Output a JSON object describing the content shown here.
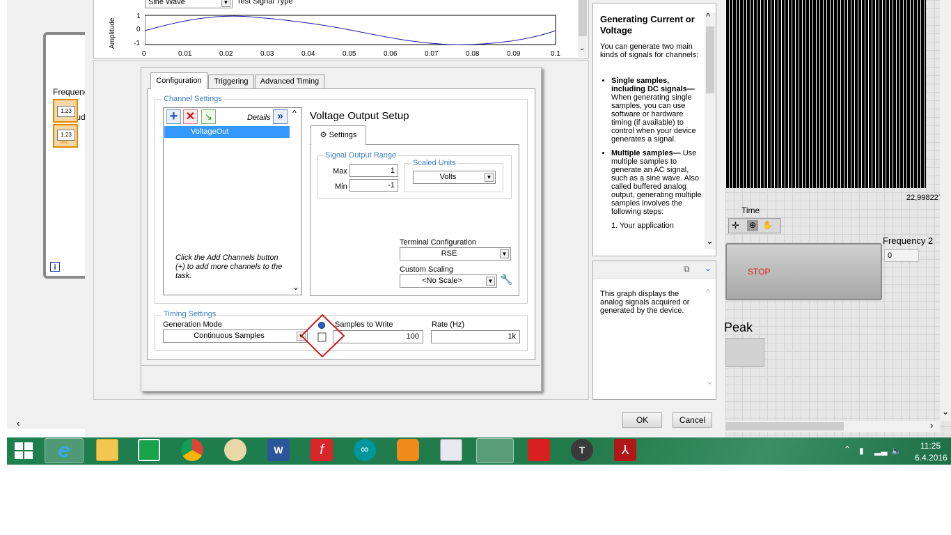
{
  "left_panel": {
    "frequency_label": "Frequenc",
    "amplitude_label": "Amplitud",
    "num_indicator_1": "1.23",
    "num_indicator_2": "1.23",
    "dbl_tag": "DBL",
    "info_icon": "i"
  },
  "test_signal": {
    "type_value": "Sine Wave",
    "type_label": "Test Signal Type",
    "y_label": "Amplitude",
    "y_ticks": [
      "1",
      "0",
      "-1"
    ],
    "x_ticks": [
      "0",
      "0.01",
      "0.02",
      "0.03",
      "0.04",
      "0.05",
      "0.06",
      "0.07",
      "0.08",
      "0.09",
      "0.1"
    ]
  },
  "dialog": {
    "tabs": {
      "configuration": "Configuration",
      "triggering": "Triggering",
      "advanced_timing": "Advanced Timing"
    },
    "channel_settings": {
      "title": "Channel Settings",
      "details_label": "Details",
      "channel": "VoltageOut",
      "hint": "Click the Add Channels button (+) to add more channels to the task."
    },
    "voltage_setup": {
      "title": "Voltage Output Setup",
      "settings_tab": "Settings",
      "signal_output_range": "Signal Output Range",
      "max_label": "Max",
      "max_value": "1",
      "min_label": "Min",
      "min_value": "-1",
      "scaled_units_label": "Scaled Units",
      "scaled_units_value": "Volts",
      "terminal_config_label": "Terminal Configuration",
      "terminal_config_value": "RSE",
      "custom_scaling_label": "Custom Scaling",
      "custom_scaling_value": "<No Scale>"
    },
    "timing": {
      "title": "Timing Settings",
      "generation_mode_label": "Generation Mode",
      "generation_mode_value": "Continuous Samples",
      "samples_label": "Samples to Write",
      "samples_value": "100",
      "rate_label": "Rate (Hz)",
      "rate_value": "1k"
    },
    "ok": "OK",
    "cancel": "Cancel"
  },
  "help": {
    "title": "Generating Current or Voltage",
    "intro": "You can generate two main kinds of signals for channels:",
    "item1_bold": "Single samples, including DC signals—",
    "item1_text": "When generating single samples, you can use software or hardware timing (if available) to control when your device generates a signal.",
    "item2_bold": "Multiple samples—",
    "item2_text": "Use multiple samples to generate an AC signal, such as a sine wave. Also called buffered analog output, generating multiple samples involves the following steps:",
    "step1": "1.   Your application",
    "graph_desc": "This graph displays the analog signals acquired or generated by the device."
  },
  "front_panel": {
    "x_readout": "22,998227",
    "time_label": "Time",
    "frequency2_label": "Frequency 2",
    "frequency2_value": "0",
    "stop_label": "STOP",
    "peak_label": "Peak"
  },
  "taskbar": {
    "time": "11:25",
    "date": "6.4.2016"
  },
  "colors": {
    "taskbar": "#1d7a4d",
    "accent_blue": "#3a7fc1",
    "selection": "#3399ff",
    "highlight_red": "#d0161b",
    "stop_text": "#e02020"
  }
}
